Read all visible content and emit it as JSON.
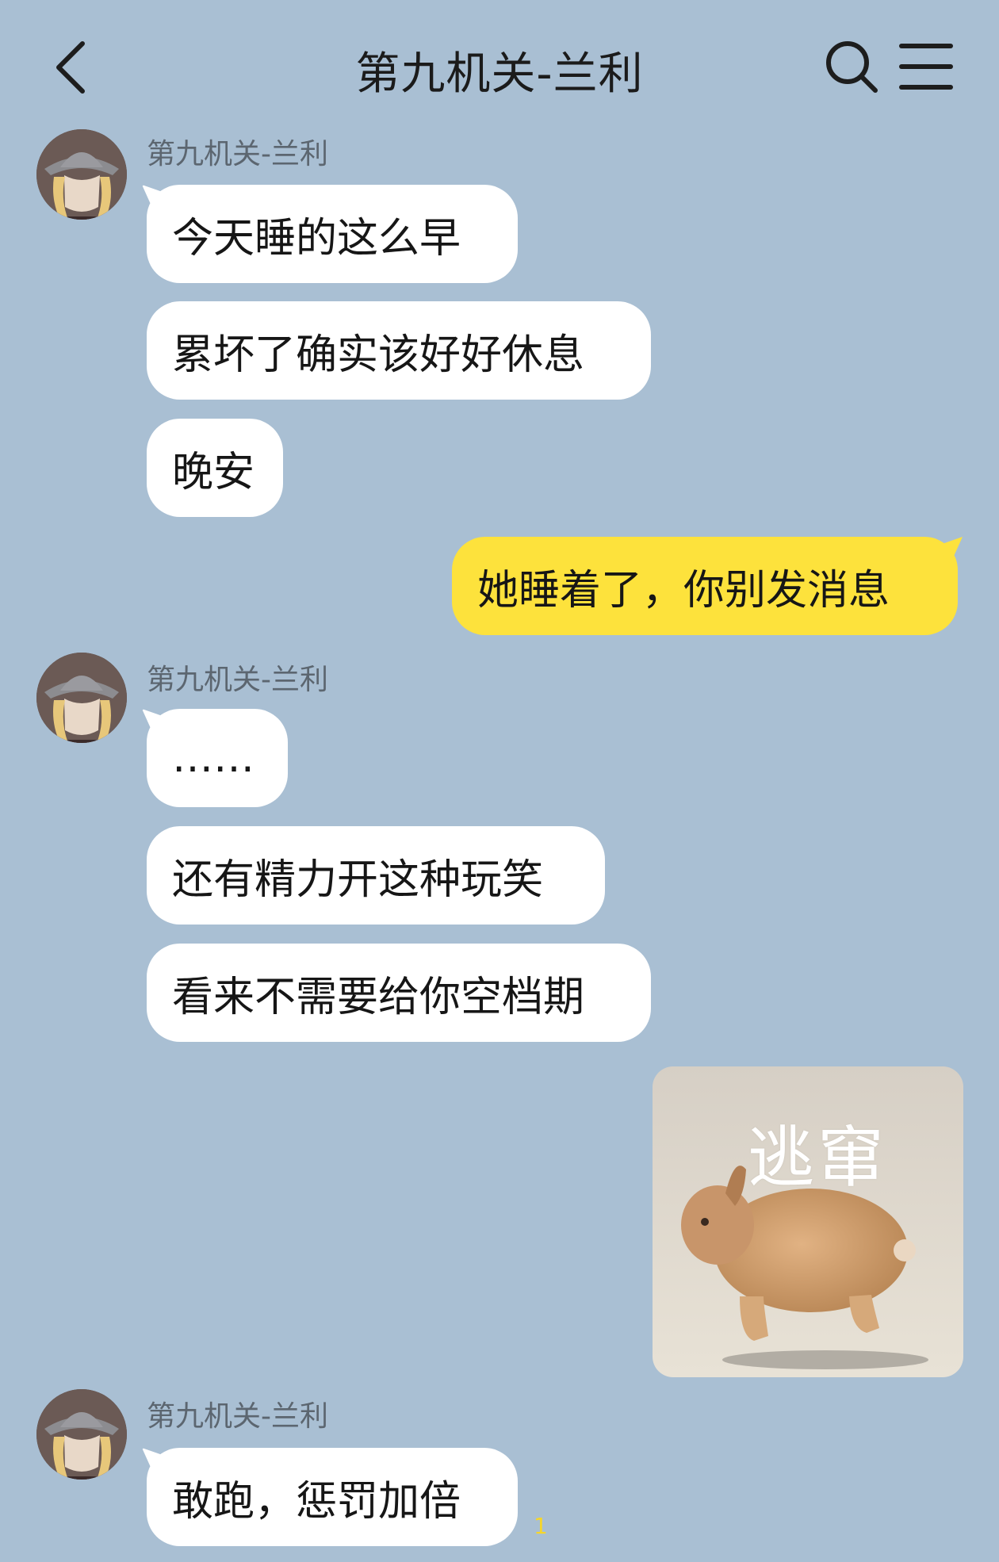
{
  "header": {
    "title": "第九机关-兰利",
    "back_icon": "chevron-left-icon",
    "search_icon": "search-icon",
    "menu_icon": "hamburger-menu-icon"
  },
  "colors": {
    "background": "#a9bfd3",
    "incoming_bubble": "#ffffff",
    "outgoing_bubble": "#fde23c",
    "unread_count": "#f6d62b"
  },
  "messages": {
    "group1": {
      "sender": "第九机关-兰利",
      "m1": "今天睡的这么早",
      "m2": "累坏了确实该好好休息",
      "m3": "晚安"
    },
    "outgoing1": "她睡着了，你别发消息",
    "group2": {
      "sender": "第九机关-兰利",
      "m1": "……",
      "m2": "还有精力开这种玩笑",
      "m3": "看来不需要给你空档期"
    },
    "sticker": {
      "caption": "逃窜",
      "icon": "rabbit-sticker"
    },
    "group3": {
      "sender": "第九机关-兰利",
      "m1": "敢跑，惩罚加倍",
      "read_count": "1"
    }
  }
}
